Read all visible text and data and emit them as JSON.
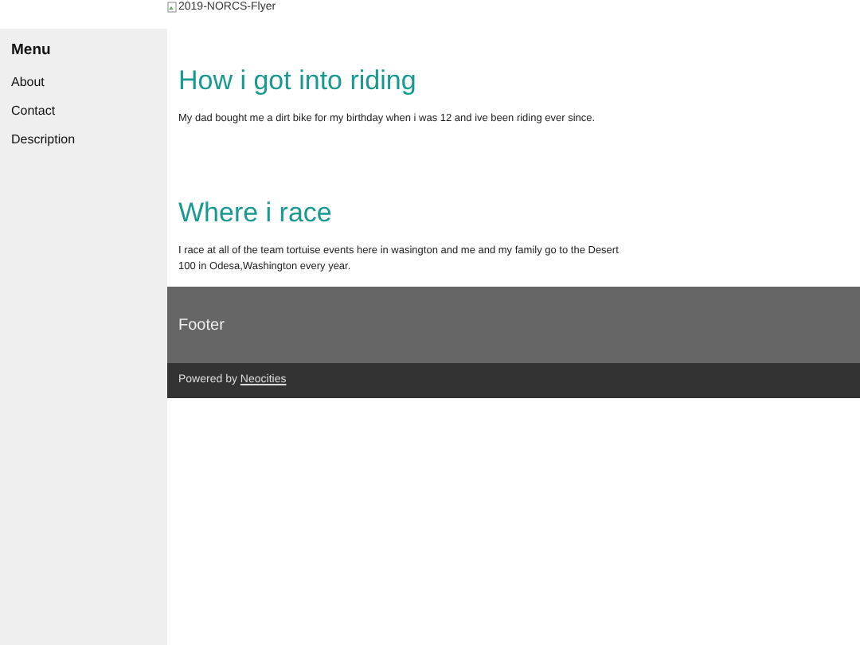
{
  "header": {
    "image_alt": "2019-NORCS-Flyer"
  },
  "sidebar": {
    "title": "Menu",
    "items": [
      {
        "label": "About"
      },
      {
        "label": "Contact"
      },
      {
        "label": "Description"
      }
    ]
  },
  "sections": [
    {
      "heading": "How i got into riding",
      "text": "My dad bought me a dirt bike for my birthday when i was 12 and ive been riding ever since."
    },
    {
      "heading": "Where i race",
      "text": "I race at all of the team tortuise events here in wasington and me and my family go to the Desert 100 in Odesa,Washington every year."
    }
  ],
  "footer": {
    "title": "Footer",
    "powered_by": "Powered by",
    "link": "Neocities"
  }
}
